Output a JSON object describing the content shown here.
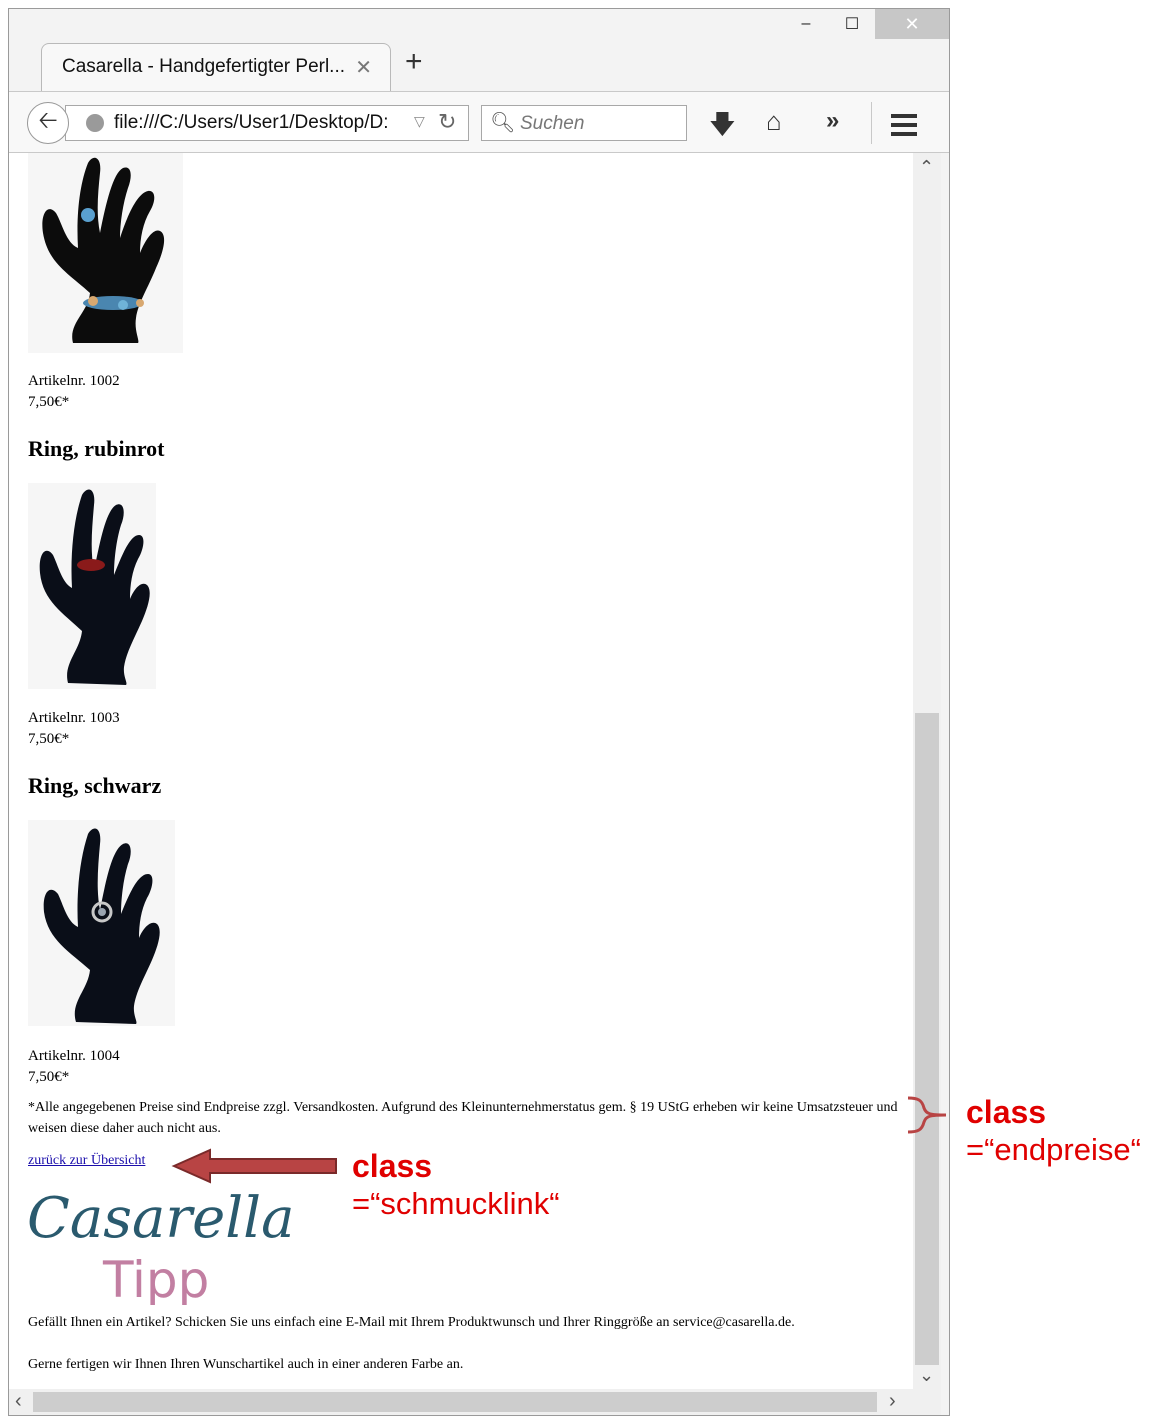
{
  "browser": {
    "tab_title": "Casarella - Handgefertigter Perl...",
    "tab_close": "✕",
    "new_tab": "+",
    "url": "file:///C:/Users/User1/Desktop/D:",
    "search_placeholder": "Suchen",
    "window_controls": {
      "minimize": "‒",
      "maximize": "☐",
      "close": "✕"
    }
  },
  "products": [
    {
      "article": "Artikelnr. 1002",
      "price": "7,50€*"
    },
    {
      "title": "Ring, rubinrot",
      "article": "Artikelnr. 1003",
      "price": "7,50€*",
      "ring_color": "#8a1a1a"
    },
    {
      "title": "Ring, schwarz",
      "article": "Artikelnr. 1004",
      "price": "7,50€*",
      "ring_color": "#c8c8c8"
    }
  ],
  "footer": {
    "note": "*Alle angegebenen Preise sind Endpreise zzgl. Versandkosten. Aufgrund des Kleinunternehmerstatus gem. § 19 UStG erheben wir keine Umsatzsteuer und weisen diese daher auch nicht aus.",
    "back_link": "zurück zur Übersicht",
    "logo_text": "Casarella",
    "logo_tipp": "Tipp",
    "tipp_text": "Gefällt Ihnen ein Artikel? Schicken Sie uns einfach eine E-Mail mit Ihrem Produktwunsch und Ihrer Ringgröße an service@casarella.de.",
    "farbe_text": "Gerne fertigen wir Ihnen Ihren Wunschartikel auch in einer anderen Farbe an."
  },
  "annotations": {
    "endpreise_label": "class",
    "endpreise_value": "=“endpreise“",
    "schmucklink_label": "class",
    "schmucklink_value": "=“schmucklink“",
    "accent_color": "#e00000",
    "arrow_color": "#b84444"
  }
}
